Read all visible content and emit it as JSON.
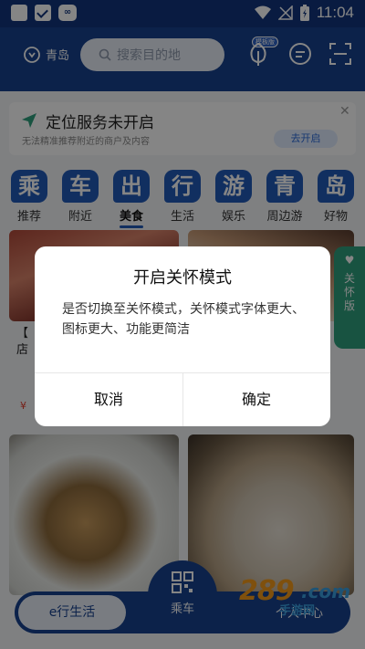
{
  "status_bar": {
    "time": "11:04",
    "icons": [
      "notification-square-icon",
      "checkbox-square-icon",
      "oa-app-icon",
      "wifi-icon",
      "no-signal-icon",
      "battery-charging-icon"
    ]
  },
  "header": {
    "city": "青岛",
    "search_placeholder": "搜索目的地",
    "badge": "模板版",
    "icons": [
      "location-pin-icon",
      "search-icon",
      "leaf-icon",
      "chat-icon",
      "scan-icon"
    ]
  },
  "notice": {
    "title": "定位服务未开启",
    "subtitle": "无法精准推荐附近的商户及内容",
    "button": "去开启"
  },
  "tiles": [
    {
      "glyph": "乘",
      "label": "推荐"
    },
    {
      "glyph": "车",
      "label": "附近"
    },
    {
      "glyph": "出",
      "label": "美食"
    },
    {
      "glyph": "行",
      "label": "生活"
    },
    {
      "glyph": "游",
      "label": "娱乐"
    },
    {
      "glyph": "青",
      "label": "周边游"
    },
    {
      "glyph": "岛",
      "label": "好物"
    }
  ],
  "active_tile": "美食",
  "care_tab": {
    "label": "关怀版"
  },
  "cards": {
    "left_partial": "【",
    "left_partial2": "店",
    "price_partial": "¥"
  },
  "bottom_nav": {
    "left": "e行生活",
    "center": "乘车",
    "right": "个人中心"
  },
  "watermark": {
    "number": "289",
    "domain": ".com",
    "sub": "手游网"
  },
  "dialog": {
    "title": "开启关怀模式",
    "message": "是否切换至关怀模式，关怀模式字体更大、图标更大、功能更简洁",
    "cancel": "取消",
    "confirm": "确定"
  },
  "colors": {
    "primary": "#17418e",
    "accent": "#215ab8",
    "care": "#2fa07e",
    "overlay": "rgba(0,0,0,0.48)"
  }
}
